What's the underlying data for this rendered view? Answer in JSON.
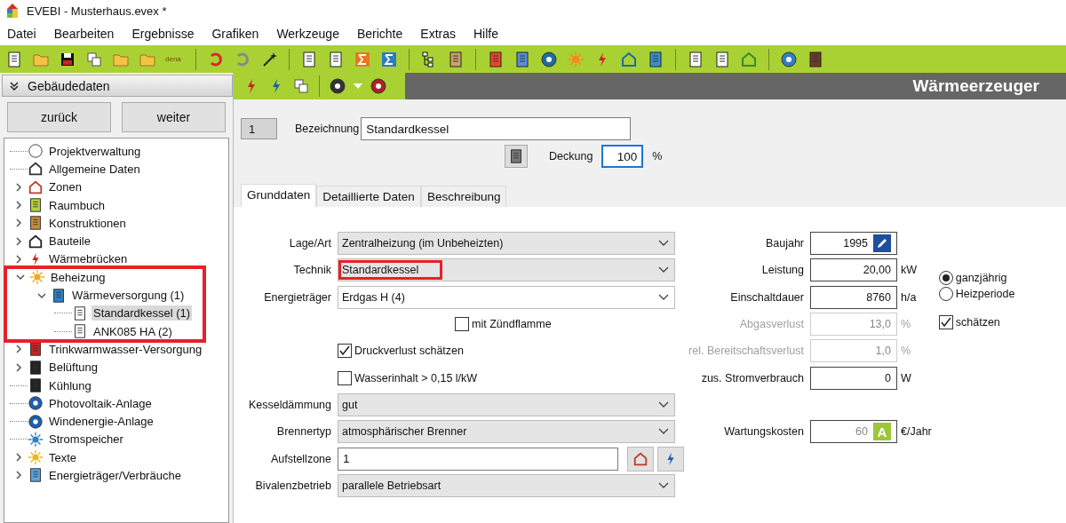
{
  "window": {
    "title": "EVEBI - Musterhaus.evex *"
  },
  "menu": [
    "Datei",
    "Bearbeiten",
    "Ergebnisse",
    "Grafiken",
    "Werkzeuge",
    "Berichte",
    "Extras",
    "Hilfe"
  ],
  "toolbar": {
    "dena_label": "dena"
  },
  "sidebar": {
    "title": "Gebäudedaten",
    "buttons": [
      "zurück",
      "weiter"
    ],
    "tree": [
      {
        "label": "Projektverwaltung",
        "kind": "leaf",
        "selected": false,
        "highlighted": false
      },
      {
        "label": "Allgemeine Daten",
        "kind": "leaf",
        "selected": false,
        "highlighted": false
      },
      {
        "label": "Zonen",
        "kind": "group",
        "expanded": false,
        "selected": false,
        "highlighted": false
      },
      {
        "label": "Raumbuch",
        "kind": "group",
        "expanded": false,
        "selected": false,
        "highlighted": false
      },
      {
        "label": "Konstruktionen",
        "kind": "group",
        "expanded": false,
        "selected": false,
        "highlighted": false
      },
      {
        "label": "Bauteile",
        "kind": "group",
        "expanded": false,
        "selected": false,
        "highlighted": false
      },
      {
        "label": "Wärmebrücken",
        "kind": "group",
        "expanded": false,
        "selected": false,
        "highlighted": false
      },
      {
        "label": "Beheizung",
        "kind": "group",
        "expanded": true,
        "selected": false,
        "highlighted": true,
        "children": [
          {
            "label": "Wärmeversorgung (1)",
            "kind": "group",
            "expanded": true,
            "selected": false,
            "highlighted": false,
            "children": [
              {
                "label": "Standardkessel (1)",
                "kind": "leaf",
                "selected": true,
                "highlighted": false
              },
              {
                "label": "ANK085 HA (2)",
                "kind": "leaf",
                "selected": false,
                "highlighted": false
              }
            ]
          }
        ]
      },
      {
        "label": "Trinkwarmwasser-Versorgung",
        "kind": "group",
        "expanded": false,
        "selected": false,
        "highlighted": false
      },
      {
        "label": "Belüftung",
        "kind": "group",
        "expanded": false,
        "selected": false,
        "highlighted": false
      },
      {
        "label": "Kühlung",
        "kind": "leaf",
        "selected": false,
        "highlighted": false
      },
      {
        "label": "Photovoltaik-Anlage",
        "kind": "leaf",
        "selected": false,
        "highlighted": false
      },
      {
        "label": "Windenergie-Anlage",
        "kind": "leaf",
        "selected": false,
        "highlighted": false
      },
      {
        "label": "Stromspeicher",
        "kind": "leaf",
        "selected": false,
        "highlighted": false
      },
      {
        "label": "Texte",
        "kind": "group",
        "expanded": false,
        "selected": false,
        "highlighted": false
      },
      {
        "label": "Energieträger/Verbräuche",
        "kind": "group",
        "expanded": false,
        "selected": false,
        "highlighted": false
      }
    ]
  },
  "panel": {
    "title": "Wärmeerzeuger",
    "number": "1",
    "name_label": "Bezeichnung",
    "name_value": "Standardkessel",
    "coverage_label": "Deckung",
    "coverage_value": "100",
    "coverage_unit": "%",
    "tabs": [
      {
        "label": "Grunddaten",
        "selected": true
      },
      {
        "label": "Detaillierte Daten",
        "selected": false
      },
      {
        "label": "Beschreibung",
        "selected": false
      }
    ],
    "left_fields": [
      {
        "kind": "select",
        "label": "Lage/Art",
        "value": "Zentralheizung (im Unbeheizten)",
        "white": false,
        "highlighted": false
      },
      {
        "kind": "select",
        "label": "Technik",
        "value": "Standardkessel",
        "white": false,
        "highlighted": true
      },
      {
        "kind": "select",
        "label": "Energieträger",
        "value": "Erdgas H (4)",
        "white": true,
        "highlighted": false
      },
      {
        "kind": "option",
        "label": "mit Zündflamme",
        "checked": false
      },
      {
        "kind": "checkbox",
        "label": "Druckverlust schätzen",
        "checked": true
      },
      {
        "kind": "checkbox",
        "label": "Wasserinhalt > 0,15 l/kW",
        "checked": false
      },
      {
        "kind": "select",
        "label": "Kesseldämmung",
        "value": "gut",
        "white": false,
        "highlighted": false
      },
      {
        "kind": "select",
        "label": "Brennertyp",
        "value": "atmosphärischer Brenner",
        "white": false,
        "highlighted": false
      },
      {
        "kind": "zone",
        "label": "Aufstellzone",
        "value": "1"
      },
      {
        "kind": "select",
        "label": "Bivalenzbetrieb",
        "value": "parallele Betriebsart",
        "white": false,
        "highlighted": false
      }
    ],
    "right_fields": [
      {
        "kind": "edit",
        "label": "Baujahr",
        "value": "1995",
        "disabled": false
      },
      {
        "kind": "plain",
        "label": "Leistung",
        "value": "20,00",
        "unit": "kW",
        "disabled": false
      },
      {
        "kind": "plain",
        "label": "Einschaltdauer",
        "value": "8760",
        "unit": "h/a",
        "disabled": false
      },
      {
        "kind": "plain",
        "label": "Abgasverlust",
        "value": "13,0",
        "unit": "%",
        "disabled": true
      },
      {
        "kind": "plain",
        "label": "rel. Bereitschaftsverlust",
        "value": "1,0",
        "unit": "%",
        "disabled": true
      },
      {
        "kind": "plain",
        "label": "zus. Stromverbrauch",
        "value": "0",
        "unit": "W",
        "disabled": false
      },
      {
        "kind": "spacer"
      },
      {
        "kind": "auto",
        "label": "Wartungskosten",
        "value": "60",
        "badge": "A",
        "unit": "€/Jahr",
        "disabled": false
      }
    ],
    "period_options": [
      {
        "label": "ganzjährig",
        "selected": true
      },
      {
        "label": "Heizperiode",
        "selected": false
      }
    ],
    "estimate": {
      "label": "schätzen",
      "checked": true
    }
  }
}
